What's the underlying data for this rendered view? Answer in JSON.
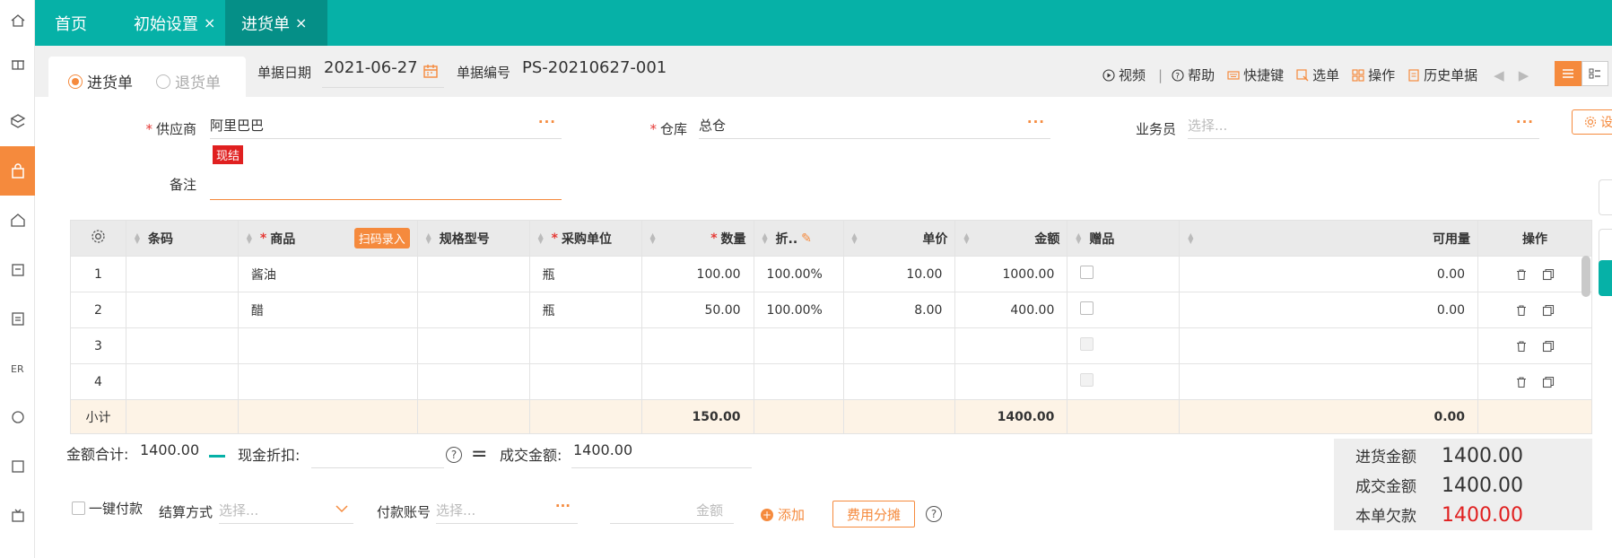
{
  "tabs": [
    {
      "label": "首页",
      "closable": false
    },
    {
      "label": "初始设置",
      "closable": true
    },
    {
      "label": "进货单",
      "closable": true,
      "active": true
    }
  ],
  "rail_icons": [
    "home-icon",
    "gift-icon",
    "settings-cube-icon",
    "shopping-bag-icon",
    "house-icon",
    "box-icon",
    "clipboard-icon",
    "er-icon",
    "cycle-icon",
    "new-icon",
    "tv-icon"
  ],
  "doc_type": {
    "purchase": "进货单",
    "return": "退货单",
    "selected": "purchase"
  },
  "header": {
    "date_label": "单据日期",
    "date_value": "2021-06-27",
    "number_label": "单据编号",
    "number_value": "PS-20210627-001"
  },
  "toolbar": {
    "video": "视频",
    "help": "帮助",
    "shortcuts": "快捷键",
    "select": "选单",
    "operate": "操作",
    "history": "历史单据"
  },
  "form": {
    "supplier_label": "供应商",
    "supplier_value": "阿里巴巴",
    "supplier_badge": "现结",
    "warehouse_label": "仓库",
    "warehouse_value": "总仓",
    "salesperson_label": "业务员",
    "salesperson_placeholder": "选择...",
    "note_label": "备注",
    "note_value": "",
    "settings_button": "设置",
    "more": "···"
  },
  "table": {
    "headers": {
      "barcode": "条码",
      "product": "商品",
      "scan": "扫码录入",
      "spec": "规格型号",
      "unit": "采购单位",
      "qty": "数量",
      "discount": "折..",
      "price": "单价",
      "amount": "金额",
      "gift": "赠品",
      "available": "可用量",
      "ops": "操作"
    },
    "rows": [
      {
        "no": "1",
        "barcode": "",
        "product": "酱油",
        "spec": "",
        "unit": "瓶",
        "qty": "100.00",
        "discount": "100.00%",
        "price": "10.00",
        "amount": "1000.00",
        "available": "0.00"
      },
      {
        "no": "2",
        "barcode": "",
        "product": "醋",
        "spec": "",
        "unit": "瓶",
        "qty": "50.00",
        "discount": "100.00%",
        "price": "8.00",
        "amount": "400.00",
        "available": "0.00"
      },
      {
        "no": "3",
        "barcode": "",
        "product": "",
        "spec": "",
        "unit": "",
        "qty": "",
        "discount": "",
        "price": "",
        "amount": "",
        "available": ""
      },
      {
        "no": "4",
        "barcode": "",
        "product": "",
        "spec": "",
        "unit": "",
        "qty": "",
        "discount": "",
        "price": "",
        "amount": "",
        "available": ""
      }
    ],
    "subtotal": {
      "label": "小计",
      "qty": "150.00",
      "amount": "1400.00",
      "available": "0.00"
    }
  },
  "totals": {
    "amount_total_label": "金额合计:",
    "amount_total_value": "1400.00",
    "cash_discount_label": "现金折扣:",
    "deal_amount_label": "成交金额:",
    "deal_amount_value": "1400.00"
  },
  "summary": {
    "purchase_amount_label": "进货金额",
    "purchase_amount_value": "1400.00",
    "deal_amount_label": "成交金额",
    "deal_amount_value": "1400.00",
    "debt_label": "本单欠款",
    "debt_value": "1400.00"
  },
  "payment": {
    "one_click_label": "一键付款",
    "method_label": "结算方式",
    "method_placeholder": "选择...",
    "account_label": "付款账号",
    "account_placeholder": "选择...",
    "amount_placeholder": "金额",
    "add_label": "添加",
    "fee_button": "费用分摊"
  },
  "colors": {
    "teal": "#06b1a7",
    "orange": "#f58a3d",
    "red": "#e02020"
  }
}
